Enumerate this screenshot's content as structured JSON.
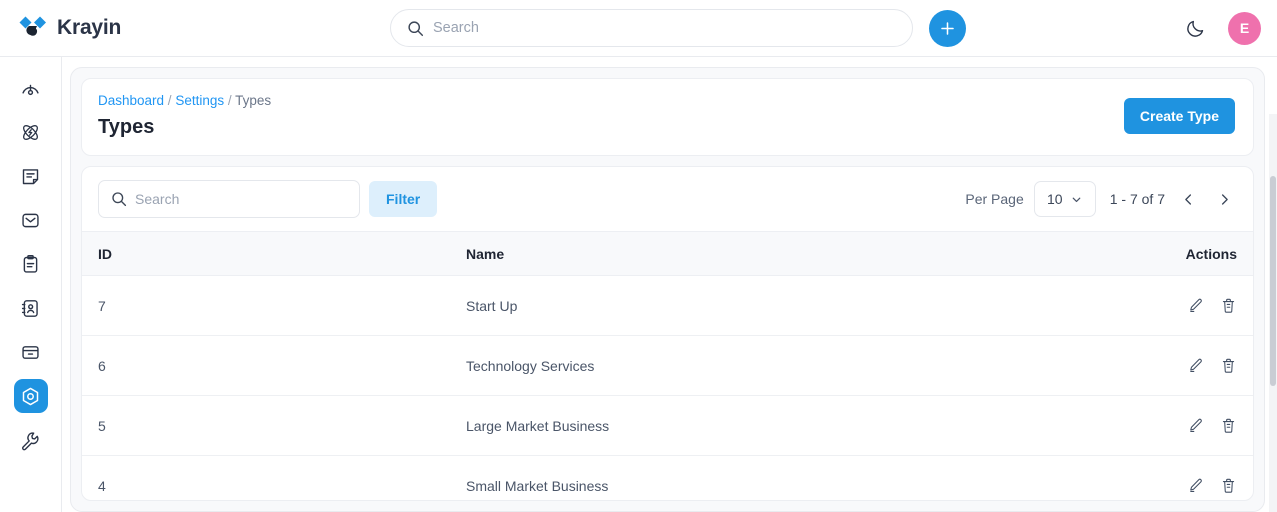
{
  "header": {
    "brand_name": "Krayin",
    "logo_icon": "krayin-logo",
    "search": {
      "placeholder": "Search",
      "value": "",
      "icon": "search-icon"
    },
    "add_button_icon": "plus-icon",
    "dark_mode_icon": "moon-icon",
    "avatar_initial": "E"
  },
  "sidebar": {
    "items": [
      {
        "name": "dashboard",
        "icon": "gauge-icon",
        "active": false
      },
      {
        "name": "activities",
        "icon": "atom-icon",
        "active": false
      },
      {
        "name": "leads",
        "icon": "note-icon",
        "active": false
      },
      {
        "name": "mail",
        "icon": "envelope-icon",
        "active": false
      },
      {
        "name": "quotes",
        "icon": "clipboard-icon",
        "active": false
      },
      {
        "name": "contacts",
        "icon": "contact-book-icon",
        "active": false
      },
      {
        "name": "products",
        "icon": "box-icon",
        "active": false
      },
      {
        "name": "settings",
        "icon": "hexagon-gear-icon",
        "active": true
      },
      {
        "name": "configuration",
        "icon": "wrench-icon",
        "active": false
      }
    ]
  },
  "page": {
    "breadcrumb": [
      {
        "label": "Dashboard",
        "link": true
      },
      {
        "label": "Settings",
        "link": true
      },
      {
        "label": "Types",
        "link": false
      }
    ],
    "breadcrumb_separator": "/",
    "title": "Types",
    "create_button": "Create Type"
  },
  "toolbar": {
    "search": {
      "placeholder": "Search",
      "value": "",
      "icon": "search-icon"
    },
    "filter_label": "Filter",
    "per_page_label": "Per Page",
    "per_page_value": "10",
    "per_page_icon": "chevron-down-icon",
    "range_text": "1 - 7 of 7",
    "prev_icon": "chevron-left-icon",
    "next_icon": "chevron-right-icon"
  },
  "table": {
    "columns": [
      "ID",
      "Name",
      "Actions"
    ],
    "rows": [
      {
        "id": "7",
        "name": "Start Up"
      },
      {
        "id": "6",
        "name": "Technology Services"
      },
      {
        "id": "5",
        "name": "Large Market Business"
      },
      {
        "id": "4",
        "name": "Small Market Business"
      }
    ],
    "row_actions": [
      {
        "name": "edit",
        "icon": "pencil-icon"
      },
      {
        "name": "delete",
        "icon": "trash-icon"
      }
    ]
  },
  "colors": {
    "primary": "#1f93e0",
    "link": "#2196f3",
    "filter_bg": "#ddeffc",
    "avatar_bg": "#ef71ad",
    "panel_bg": "#f8f9fb",
    "border": "#e9ebef",
    "text": "#1f2533",
    "muted": "#6b7689"
  }
}
